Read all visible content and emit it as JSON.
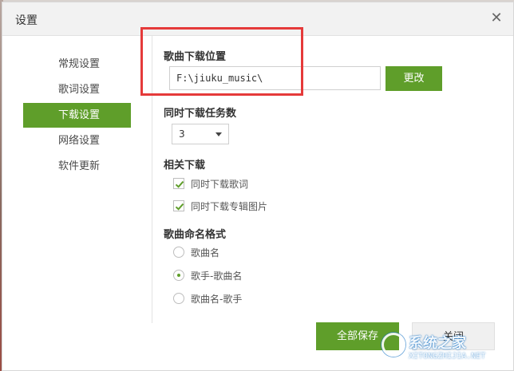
{
  "window": {
    "title": "设置",
    "close_icon": "close-icon"
  },
  "sidebar": {
    "items": [
      {
        "label": "常规设置",
        "active": false
      },
      {
        "label": "歌词设置",
        "active": false
      },
      {
        "label": "下载设置",
        "active": true
      },
      {
        "label": "网络设置",
        "active": false
      },
      {
        "label": "软件更新",
        "active": false
      }
    ]
  },
  "download": {
    "location_title": "歌曲下载位置",
    "path_value": "F:\\jiuku_music\\",
    "change_label": "更改",
    "tasks_title": "同时下载任务数",
    "tasks_value": "3",
    "related_title": "相关下载",
    "options": [
      {
        "label": "同时下载歌词",
        "checked": true
      },
      {
        "label": "同时下载专辑图片",
        "checked": true
      }
    ],
    "naming_title": "歌曲命名格式",
    "naming_options": [
      {
        "label": "歌曲名",
        "selected": false
      },
      {
        "label": "歌手-歌曲名",
        "selected": true
      },
      {
        "label": "歌曲名-歌手",
        "selected": false
      }
    ]
  },
  "footer": {
    "save_label": "全部保存",
    "close_label": "关闭"
  },
  "watermark": {
    "text": "系统之家",
    "subtext": "XITONGZHIJIA.NET"
  },
  "colors": {
    "accent": "#5f9e2a",
    "highlight": "#e53a3a"
  }
}
